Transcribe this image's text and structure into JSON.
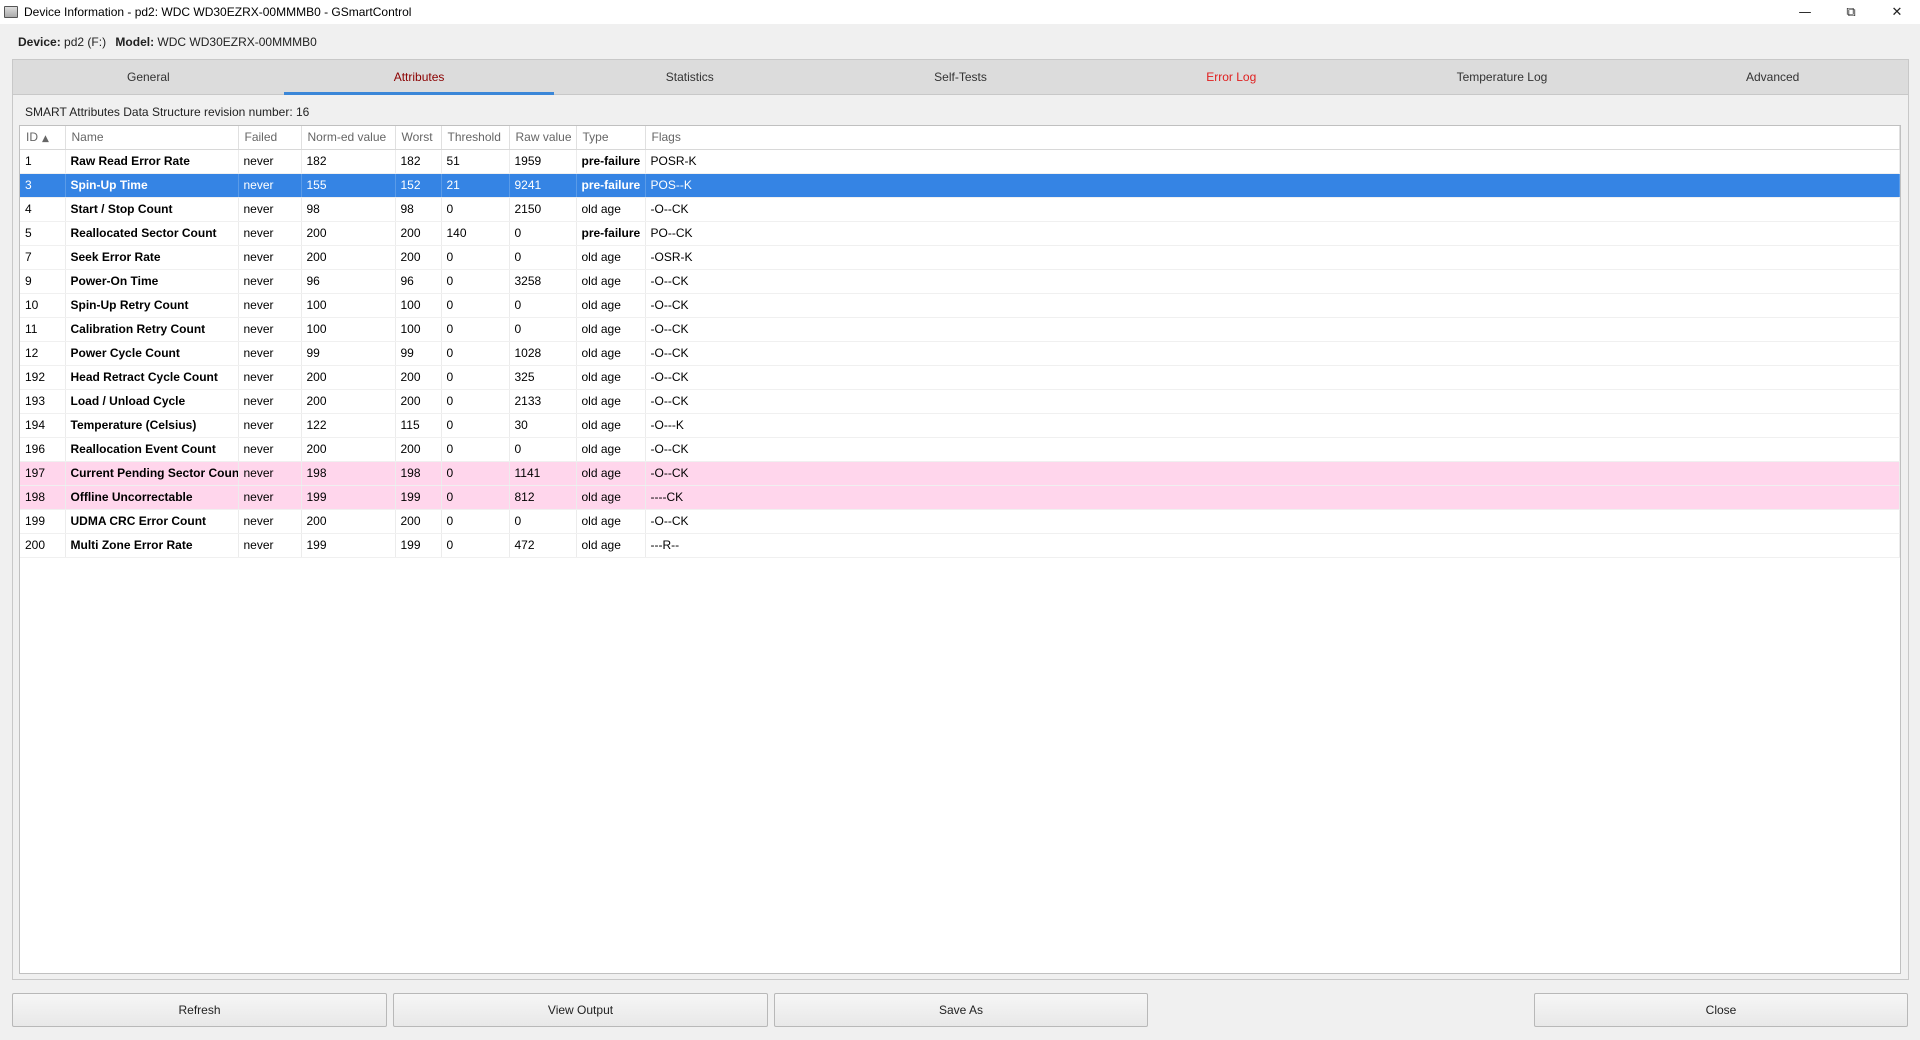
{
  "window": {
    "title": "Device Information - pd2: WDC WD30EZRX-00MMMB0 - GSmartControl",
    "minimize": "—",
    "maximize": "⧉",
    "close": "✕"
  },
  "device": {
    "device_label": "Device:",
    "device_value": "pd2 (F:)",
    "model_label": "Model:",
    "model_value": "WDC WD30EZRX-00MMMB0"
  },
  "tabs": [
    {
      "label": "General"
    },
    {
      "label": "Attributes"
    },
    {
      "label": "Statistics"
    },
    {
      "label": "Self-Tests"
    },
    {
      "label": "Error Log"
    },
    {
      "label": "Temperature Log"
    },
    {
      "label": "Advanced"
    }
  ],
  "attributes": {
    "revision_text": "SMART Attributes Data Structure revision number: 16",
    "columns": [
      "ID",
      "Name",
      "Failed",
      "Norm-ed value",
      "Worst",
      "Threshold",
      "Raw value",
      "Type",
      "Flags"
    ],
    "rows": [
      {
        "id": "1",
        "name": "Raw Read Error Rate",
        "failed": "never",
        "norm": "182",
        "worst": "182",
        "threshold": "51",
        "raw": "1959",
        "type": "pre-failure",
        "flags": "POSR-K"
      },
      {
        "id": "3",
        "name": "Spin-Up Time",
        "failed": "never",
        "norm": "155",
        "worst": "152",
        "threshold": "21",
        "raw": "9241",
        "type": "pre-failure",
        "flags": "POS--K"
      },
      {
        "id": "4",
        "name": "Start / Stop Count",
        "failed": "never",
        "norm": "98",
        "worst": "98",
        "threshold": "0",
        "raw": "2150",
        "type": "old age",
        "flags": "-O--CK"
      },
      {
        "id": "5",
        "name": "Reallocated Sector Count",
        "failed": "never",
        "norm": "200",
        "worst": "200",
        "threshold": "140",
        "raw": "0",
        "type": "pre-failure",
        "flags": "PO--CK"
      },
      {
        "id": "7",
        "name": "Seek Error Rate",
        "failed": "never",
        "norm": "200",
        "worst": "200",
        "threshold": "0",
        "raw": "0",
        "type": "old age",
        "flags": "-OSR-K"
      },
      {
        "id": "9",
        "name": "Power-On Time",
        "failed": "never",
        "norm": "96",
        "worst": "96",
        "threshold": "0",
        "raw": "3258",
        "type": "old age",
        "flags": "-O--CK"
      },
      {
        "id": "10",
        "name": "Spin-Up Retry Count",
        "failed": "never",
        "norm": "100",
        "worst": "100",
        "threshold": "0",
        "raw": "0",
        "type": "old age",
        "flags": "-O--CK"
      },
      {
        "id": "11",
        "name": "Calibration Retry Count",
        "failed": "never",
        "norm": "100",
        "worst": "100",
        "threshold": "0",
        "raw": "0",
        "type": "old age",
        "flags": "-O--CK"
      },
      {
        "id": "12",
        "name": "Power Cycle Count",
        "failed": "never",
        "norm": "99",
        "worst": "99",
        "threshold": "0",
        "raw": "1028",
        "type": "old age",
        "flags": "-O--CK"
      },
      {
        "id": "192",
        "name": "Head Retract Cycle Count",
        "failed": "never",
        "norm": "200",
        "worst": "200",
        "threshold": "0",
        "raw": "325",
        "type": "old age",
        "flags": "-O--CK"
      },
      {
        "id": "193",
        "name": "Load / Unload Cycle",
        "failed": "never",
        "norm": "200",
        "worst": "200",
        "threshold": "0",
        "raw": "2133",
        "type": "old age",
        "flags": "-O--CK"
      },
      {
        "id": "194",
        "name": "Temperature (Celsius)",
        "failed": "never",
        "norm": "122",
        "worst": "115",
        "threshold": "0",
        "raw": "30",
        "type": "old age",
        "flags": "-O---K"
      },
      {
        "id": "196",
        "name": "Reallocation Event Count",
        "failed": "never",
        "norm": "200",
        "worst": "200",
        "threshold": "0",
        "raw": "0",
        "type": "old age",
        "flags": "-O--CK"
      },
      {
        "id": "197",
        "name": "Current Pending Sector Count",
        "failed": "never",
        "norm": "198",
        "worst": "198",
        "threshold": "0",
        "raw": "1141",
        "type": "old age",
        "flags": "-O--CK"
      },
      {
        "id": "198",
        "name": "Offline Uncorrectable",
        "failed": "never",
        "norm": "199",
        "worst": "199",
        "threshold": "0",
        "raw": "812",
        "type": "old age",
        "flags": "----CK"
      },
      {
        "id": "199",
        "name": "UDMA CRC Error Count",
        "failed": "never",
        "norm": "200",
        "worst": "200",
        "threshold": "0",
        "raw": "0",
        "type": "old age",
        "flags": "-O--CK"
      },
      {
        "id": "200",
        "name": "Multi Zone Error Rate",
        "failed": "never",
        "norm": "199",
        "worst": "199",
        "threshold": "0",
        "raw": "472",
        "type": "old age",
        "flags": "---R--"
      }
    ]
  },
  "buttons": {
    "refresh": "Refresh",
    "view_output": "View Output",
    "save_as": "Save As",
    "close": "Close"
  },
  "colors": {
    "selection": "#3584e4",
    "warning_row": "#ffd6ec",
    "error_tab": "#e02020",
    "active_tab": "#8b0000"
  }
}
